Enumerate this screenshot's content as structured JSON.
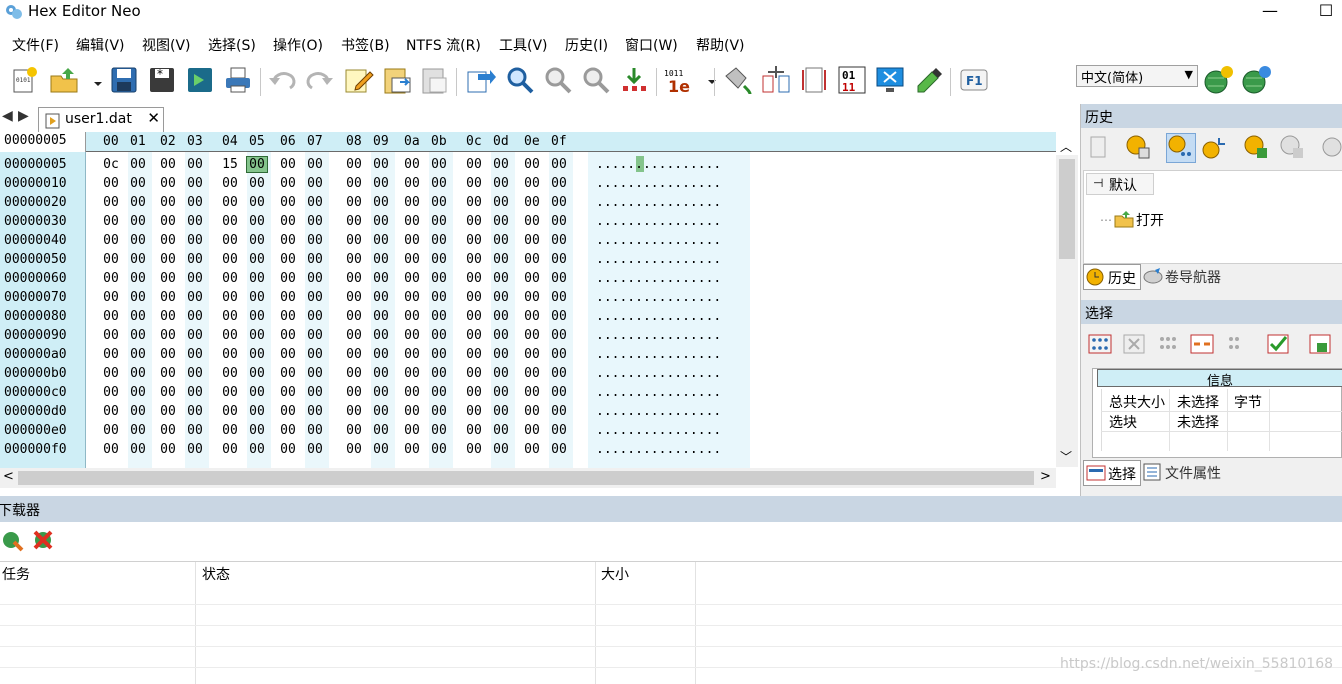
{
  "window": {
    "title": "Hex Editor Neo",
    "minimize": "—",
    "maximize": "☐"
  },
  "menu": [
    "文件(F)",
    "编辑(V)",
    "视图(V)",
    "选择(S)",
    "操作(O)",
    "书签(B)",
    "NTFS 流(R)",
    "工具(V)",
    "历史(I)",
    "窗口(W)",
    "帮助(V)"
  ],
  "language": "中文(简体)",
  "tab": {
    "filename": "user1.dat",
    "close": "✕"
  },
  "hex": {
    "current_offset": "00000005",
    "columns": [
      "00",
      "01",
      "02",
      "03",
      "04",
      "05",
      "06",
      "07",
      "08",
      "09",
      "0a",
      "0b",
      "0c",
      "0d",
      "0e",
      "0f"
    ],
    "selected_column": 5,
    "rows": [
      {
        "offset": "00000005",
        "bytes": [
          "0c",
          "00",
          "00",
          "00",
          "15",
          "00",
          "00",
          "00",
          "00",
          "00",
          "00",
          "00",
          "00",
          "00",
          "00",
          "00"
        ],
        "ascii": "................"
      },
      {
        "offset": "00000010",
        "bytes": [
          "00",
          "00",
          "00",
          "00",
          "00",
          "00",
          "00",
          "00",
          "00",
          "00",
          "00",
          "00",
          "00",
          "00",
          "00",
          "00"
        ],
        "ascii": "................"
      },
      {
        "offset": "00000020",
        "bytes": [
          "00",
          "00",
          "00",
          "00",
          "00",
          "00",
          "00",
          "00",
          "00",
          "00",
          "00",
          "00",
          "00",
          "00",
          "00",
          "00"
        ],
        "ascii": "................"
      },
      {
        "offset": "00000030",
        "bytes": [
          "00",
          "00",
          "00",
          "00",
          "00",
          "00",
          "00",
          "00",
          "00",
          "00",
          "00",
          "00",
          "00",
          "00",
          "00",
          "00"
        ],
        "ascii": "................"
      },
      {
        "offset": "00000040",
        "bytes": [
          "00",
          "00",
          "00",
          "00",
          "00",
          "00",
          "00",
          "00",
          "00",
          "00",
          "00",
          "00",
          "00",
          "00",
          "00",
          "00"
        ],
        "ascii": "................"
      },
      {
        "offset": "00000050",
        "bytes": [
          "00",
          "00",
          "00",
          "00",
          "00",
          "00",
          "00",
          "00",
          "00",
          "00",
          "00",
          "00",
          "00",
          "00",
          "00",
          "00"
        ],
        "ascii": "................"
      },
      {
        "offset": "00000060",
        "bytes": [
          "00",
          "00",
          "00",
          "00",
          "00",
          "00",
          "00",
          "00",
          "00",
          "00",
          "00",
          "00",
          "00",
          "00",
          "00",
          "00"
        ],
        "ascii": "................"
      },
      {
        "offset": "00000070",
        "bytes": [
          "00",
          "00",
          "00",
          "00",
          "00",
          "00",
          "00",
          "00",
          "00",
          "00",
          "00",
          "00",
          "00",
          "00",
          "00",
          "00"
        ],
        "ascii": "................"
      },
      {
        "offset": "00000080",
        "bytes": [
          "00",
          "00",
          "00",
          "00",
          "00",
          "00",
          "00",
          "00",
          "00",
          "00",
          "00",
          "00",
          "00",
          "00",
          "00",
          "00"
        ],
        "ascii": "................"
      },
      {
        "offset": "00000090",
        "bytes": [
          "00",
          "00",
          "00",
          "00",
          "00",
          "00",
          "00",
          "00",
          "00",
          "00",
          "00",
          "00",
          "00",
          "00",
          "00",
          "00"
        ],
        "ascii": "................"
      },
      {
        "offset": "000000a0",
        "bytes": [
          "00",
          "00",
          "00",
          "00",
          "00",
          "00",
          "00",
          "00",
          "00",
          "00",
          "00",
          "00",
          "00",
          "00",
          "00",
          "00"
        ],
        "ascii": "................"
      },
      {
        "offset": "000000b0",
        "bytes": [
          "00",
          "00",
          "00",
          "00",
          "00",
          "00",
          "00",
          "00",
          "00",
          "00",
          "00",
          "00",
          "00",
          "00",
          "00",
          "00"
        ],
        "ascii": "................"
      },
      {
        "offset": "000000c0",
        "bytes": [
          "00",
          "00",
          "00",
          "00",
          "00",
          "00",
          "00",
          "00",
          "00",
          "00",
          "00",
          "00",
          "00",
          "00",
          "00",
          "00"
        ],
        "ascii": "................"
      },
      {
        "offset": "000000d0",
        "bytes": [
          "00",
          "00",
          "00",
          "00",
          "00",
          "00",
          "00",
          "00",
          "00",
          "00",
          "00",
          "00",
          "00",
          "00",
          "00",
          "00"
        ],
        "ascii": "................"
      },
      {
        "offset": "000000e0",
        "bytes": [
          "00",
          "00",
          "00",
          "00",
          "00",
          "00",
          "00",
          "00",
          "00",
          "00",
          "00",
          "00",
          "00",
          "00",
          "00",
          "00"
        ],
        "ascii": "................"
      },
      {
        "offset": "000000f0",
        "bytes": [
          "00",
          "00",
          "00",
          "00",
          "00",
          "00",
          "00",
          "00",
          "00",
          "00",
          "00",
          "00",
          "00",
          "00",
          "00",
          "00"
        ],
        "ascii": "................"
      }
    ]
  },
  "history_panel": {
    "title": "历史",
    "tree_root": "默认",
    "tree_item": "打开",
    "tabs": [
      "历史",
      "卷导航器"
    ]
  },
  "selection_panel": {
    "title": "选择",
    "info_header": "信息",
    "rows": [
      [
        "总共大小",
        "未选择",
        "字节"
      ],
      [
        "选块",
        "未选择",
        ""
      ]
    ],
    "tabs": [
      "选择",
      "文件属性"
    ]
  },
  "downloader": {
    "title": "下载器",
    "columns": [
      "任务",
      "状态",
      "大小"
    ]
  },
  "watermark": "https://blog.csdn.net/weixin_55810168"
}
